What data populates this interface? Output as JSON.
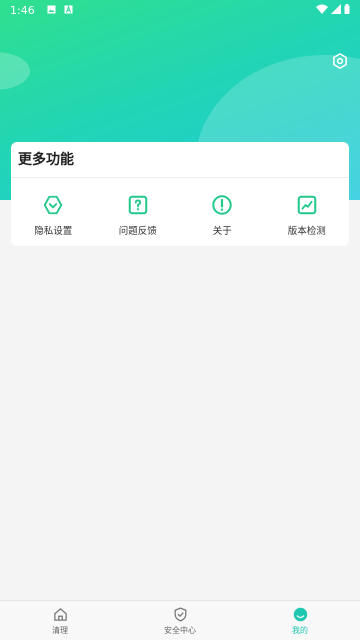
{
  "status_bar": {
    "time": "1:46",
    "icons": [
      "image-icon",
      "a-icon",
      "wifi-icon",
      "signal-icon",
      "battery-icon"
    ]
  },
  "header": {
    "settings_icon": "gear-icon"
  },
  "more_features": {
    "title": "更多功能",
    "items": [
      {
        "label": "隐私设置",
        "icon": "privacy-hex-icon"
      },
      {
        "label": "问题反馈",
        "icon": "question-box-icon"
      },
      {
        "label": "关于",
        "icon": "exclamation-circle-icon"
      },
      {
        "label": "版本检测",
        "icon": "chart-line-icon"
      }
    ]
  },
  "bottom_nav": {
    "items": [
      {
        "label": "清理",
        "icon": "home-icon",
        "active": false
      },
      {
        "label": "安全中心",
        "icon": "shield-check-icon",
        "active": false
      },
      {
        "label": "我的",
        "icon": "profile-icon",
        "active": true
      }
    ]
  },
  "colors": {
    "accent": "#1fc6b0",
    "icon_green": "#22c98a",
    "gradient_start": "#2fe08e",
    "gradient_end": "#1ec8dc"
  }
}
